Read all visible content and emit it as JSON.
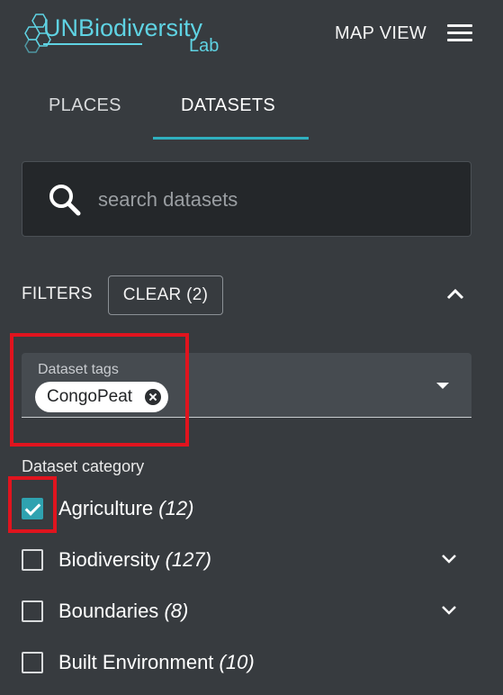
{
  "header": {
    "logo_main": "UNBiodiversity",
    "logo_sub": "Lab",
    "map_view_label": "MAP VIEW",
    "menu_icon": "hamburger-menu-icon"
  },
  "tabs": [
    {
      "label": "PLACES",
      "active": false
    },
    {
      "label": "DATASETS",
      "active": true
    }
  ],
  "search": {
    "placeholder": "search datasets",
    "value": "",
    "icon": "search-icon"
  },
  "filters": {
    "label": "FILTERS",
    "clear_label": "CLEAR (2)",
    "collapse_icon": "chevron-up-icon"
  },
  "dataset_tags": {
    "label": "Dataset tags",
    "selected": [
      "CongoPeat"
    ],
    "dropdown_icon": "arrow-drop-down-icon"
  },
  "dataset_category": {
    "title": "Dataset category",
    "items": [
      {
        "name": "Agriculture",
        "count": "(12)",
        "checked": true,
        "expandable": false
      },
      {
        "name": "Biodiversity",
        "count": "(127)",
        "checked": false,
        "expandable": true
      },
      {
        "name": "Boundaries",
        "count": "(8)",
        "checked": false,
        "expandable": true
      },
      {
        "name": "Built Environment",
        "count": "(10)",
        "checked": false,
        "expandable": false
      }
    ]
  },
  "colors": {
    "background": "#373b3f",
    "accent": "#2fb0bf",
    "search_bg": "#24272a",
    "highlight": "#e0141e"
  }
}
